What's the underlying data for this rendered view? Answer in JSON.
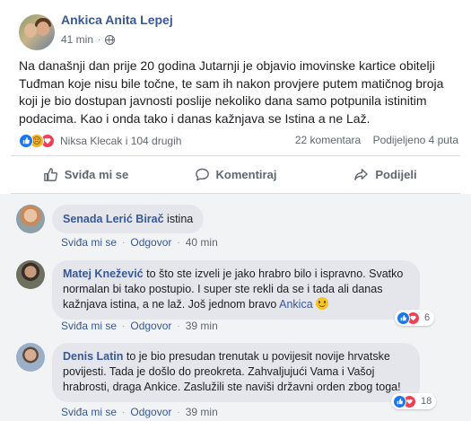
{
  "post": {
    "author": "Ankica Anita Lepej",
    "time": "41 min",
    "separator": "·",
    "privacy_icon": "globe-icon",
    "text": "Na današnji dan prije 20 godina Jutarnji je objavio imovinske kartice obitelji Tuđman koje nisu bile točne, te sam ih nakon provjere putem matičnog broja koji je bio dostupan javnosti poslije nekoliko dana samo potpunila istinitim podacima. Kao i onda tako i danas kažnjava se Istina a ne Laž.",
    "reactions": {
      "icons": [
        "like-icon",
        "sad-icon",
        "love-icon"
      ],
      "summary": "Niksa Klecak i 104 drugih"
    },
    "comments_count": "22 komentara",
    "shares_count": "Podijeljeno 4 puta",
    "actions": {
      "like": "Sviđa mi se",
      "comment": "Komentiraj",
      "share": "Podijeli"
    }
  },
  "comments": [
    {
      "author": "Senada Lerić Birač",
      "text": "istina",
      "like": "Sviđa mi se",
      "reply": "Odgovor",
      "time": "40 min"
    },
    {
      "author": "Matej Knežević",
      "text": "to što ste izveli je jako hrabro bilo i ispravno. Svatko normalan bi tako postupio. I super ste rekli da se i tada ali danas kažnjava istina, a ne laž. Još jednom bravo",
      "mention": "Ankica",
      "like": "Sviđa mi se",
      "reply": "Odgovor",
      "time": "39 min",
      "reaction_count": "6"
    },
    {
      "author": "Denis Latin",
      "text": "to je bio presudan trenutak u povijesit novije hrvatske povijesti. Tada je došlo do preokreta. Zahvaljujući Vama i Vašoj hrabrosti, draga Ankice. Zaslužili ste naviši državni orden zbog toga!",
      "like": "Sviđa mi se",
      "reply": "Odgovor",
      "time": "39 min",
      "reaction_count": "18"
    }
  ],
  "colors": {
    "link_blue": "#385898",
    "like_blue": "#1877f2",
    "love_red": "#f33e58",
    "comment_bg": "#f2f3f5",
    "bubble_bg": "#e4e6eb"
  }
}
